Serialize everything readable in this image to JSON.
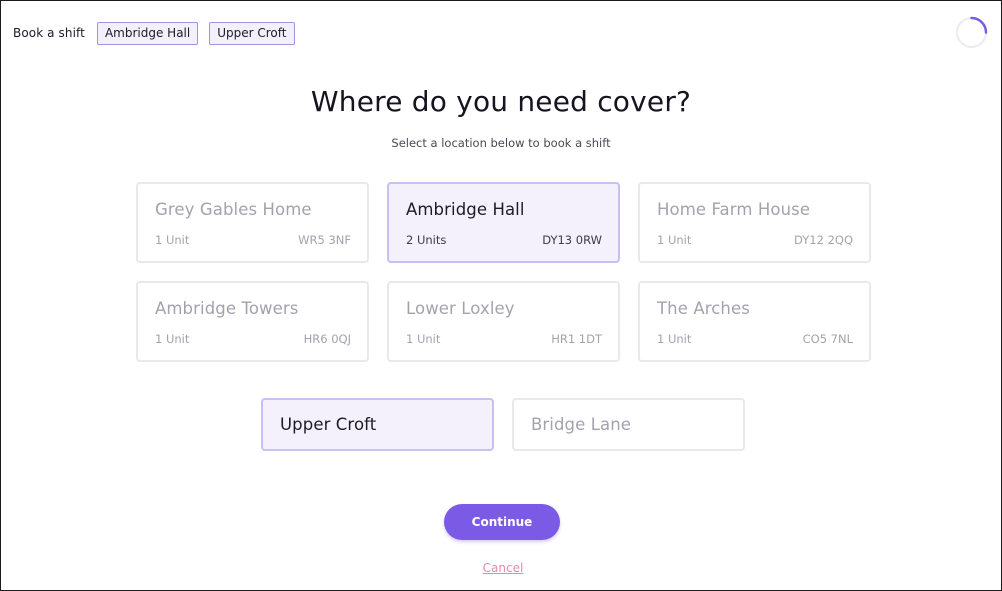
{
  "header": {
    "label": "Book a shift",
    "chips": [
      "Ambridge Hall",
      "Upper Croft"
    ]
  },
  "main": {
    "title": "Where do you need cover?",
    "subtitle": "Select a location below to book a shift"
  },
  "locations": [
    {
      "name": "Grey Gables Home",
      "units": "1 Unit",
      "postcode": "WR5 3NF",
      "selected": false
    },
    {
      "name": "Ambridge Hall",
      "units": "2 Units",
      "postcode": "DY13 0RW",
      "selected": true
    },
    {
      "name": "Home Farm House",
      "units": "1 Unit",
      "postcode": "DY12 2QQ",
      "selected": false
    },
    {
      "name": "Ambridge Towers",
      "units": "1 Unit",
      "postcode": "HR6 0QJ",
      "selected": false
    },
    {
      "name": "Lower Loxley",
      "units": "1 Unit",
      "postcode": "HR1 1DT",
      "selected": false
    },
    {
      "name": "The Arches",
      "units": "1 Unit",
      "postcode": "CO5 7NL",
      "selected": false
    }
  ],
  "units": [
    {
      "name": "Upper Croft",
      "selected": true
    },
    {
      "name": "Bridge Lane",
      "selected": false
    }
  ],
  "actions": {
    "continue_label": "Continue",
    "cancel_label": "Cancel"
  },
  "colors": {
    "accent": "#7b5ae6",
    "selected_bg": "#f4f1fc",
    "selected_border": "#c9bff1",
    "cancel": "#e58aa9"
  },
  "icons": {
    "loading": "loading-spinner-icon"
  }
}
